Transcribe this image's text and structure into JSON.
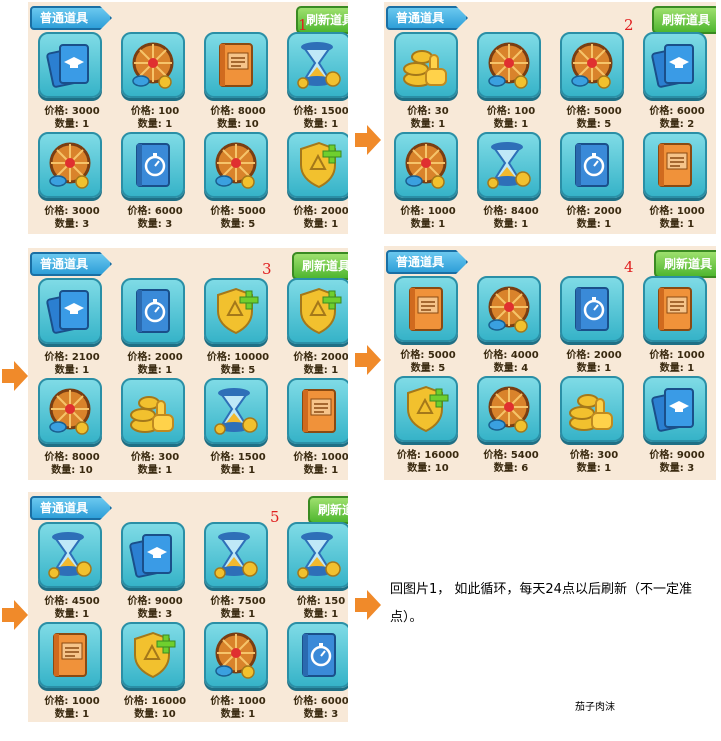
{
  "header": {
    "tab_label": "普通道具",
    "refresh_label": "刷新道具"
  },
  "panels": [
    {
      "index": "1",
      "items": [
        {
          "icon": "cards-icon",
          "price": "价格: 3000",
          "qty": "数量: 1"
        },
        {
          "icon": "wheel-icon",
          "price": "价格: 100",
          "qty": "数量: 1"
        },
        {
          "icon": "book-icon",
          "price": "价格: 8000",
          "qty": "数量: 10"
        },
        {
          "icon": "hourglass-icon",
          "price": "价格: 1500",
          "qty": "数量: 1"
        },
        {
          "icon": "wheel-icon",
          "price": "价格: 3000",
          "qty": "数量: 3"
        },
        {
          "icon": "stopwatch-book-icon",
          "price": "价格: 6000",
          "qty": "数量: 3"
        },
        {
          "icon": "wheel-icon",
          "price": "价格: 5000",
          "qty": "数量: 5"
        },
        {
          "icon": "shield-plus-icon",
          "price": "价格: 2000",
          "qty": "数量: 1"
        }
      ]
    },
    {
      "index": "2",
      "items": [
        {
          "icon": "coin-hand-icon",
          "price": "价格: 30",
          "qty": "数量: 1"
        },
        {
          "icon": "wheel-icon",
          "price": "价格: 100",
          "qty": "数量: 1"
        },
        {
          "icon": "wheel-icon",
          "price": "价格: 5000",
          "qty": "数量: 5"
        },
        {
          "icon": "cards-icon",
          "price": "价格: 6000",
          "qty": "数量: 2"
        },
        {
          "icon": "wheel-icon",
          "price": "价格: 1000",
          "qty": "数量: 1"
        },
        {
          "icon": "hourglass-icon",
          "price": "价格: 8400",
          "qty": "数量: 1"
        },
        {
          "icon": "stopwatch-book-icon",
          "price": "价格: 2000",
          "qty": "数量: 1"
        },
        {
          "icon": "book-icon",
          "price": "价格: 1000",
          "qty": "数量: 1"
        }
      ]
    },
    {
      "index": "3",
      "items": [
        {
          "icon": "cards-icon",
          "price": "价格: 2100",
          "qty": "数量: 1"
        },
        {
          "icon": "stopwatch-book-icon",
          "price": "价格: 2000",
          "qty": "数量: 1"
        },
        {
          "icon": "shield-plus-icon",
          "price": "价格: 10000",
          "qty": "数量: 5"
        },
        {
          "icon": "shield-plus-icon",
          "price": "价格: 2000",
          "qty": "数量: 1"
        },
        {
          "icon": "wheel-icon",
          "price": "价格: 8000",
          "qty": "数量: 10"
        },
        {
          "icon": "coin-hand-icon",
          "price": "价格: 300",
          "qty": "数量: 1"
        },
        {
          "icon": "hourglass-icon",
          "price": "价格: 1500",
          "qty": "数量: 1"
        },
        {
          "icon": "book-icon",
          "price": "价格: 1000",
          "qty": "数量: 1"
        }
      ]
    },
    {
      "index": "4",
      "items": [
        {
          "icon": "book-icon",
          "price": "价格: 5000",
          "qty": "数量: 5"
        },
        {
          "icon": "wheel-icon",
          "price": "价格: 4000",
          "qty": "数量: 4"
        },
        {
          "icon": "stopwatch-book-icon",
          "price": "价格: 2000",
          "qty": "数量: 1"
        },
        {
          "icon": "book-icon",
          "price": "价格: 1000",
          "qty": "数量: 1"
        },
        {
          "icon": "shield-plus-icon",
          "price": "价格: 16000",
          "qty": "数量: 10"
        },
        {
          "icon": "wheel-icon",
          "price": "价格: 5400",
          "qty": "数量: 6"
        },
        {
          "icon": "coin-hand-icon",
          "price": "价格: 300",
          "qty": "数量: 1"
        },
        {
          "icon": "cards-icon",
          "price": "价格: 9000",
          "qty": "数量: 3"
        }
      ]
    },
    {
      "index": "5",
      "items": [
        {
          "icon": "hourglass-icon",
          "price": "价格: 4500",
          "qty": "数量: 1"
        },
        {
          "icon": "cards-icon",
          "price": "价格: 9000",
          "qty": "数量: 3"
        },
        {
          "icon": "hourglass-icon",
          "price": "价格: 7500",
          "qty": "数量: 1"
        },
        {
          "icon": "hourglass-icon",
          "price": "价格: 150",
          "qty": "数量: 1"
        },
        {
          "icon": "book-icon",
          "price": "价格: 1000",
          "qty": "数量: 1"
        },
        {
          "icon": "shield-plus-icon",
          "price": "价格: 16000",
          "qty": "数量: 10"
        },
        {
          "icon": "wheel-icon",
          "price": "价格: 1000",
          "qty": "数量: 1"
        },
        {
          "icon": "stopwatch-book-icon",
          "price": "价格: 6000",
          "qty": "数量: 3"
        }
      ]
    }
  ],
  "note": "回图片1， 如此循环，每天24点以后刷新（不一定准点）。",
  "signature": "茄子肉沫",
  "colors": {
    "arrow": "#f08a2a",
    "panel_bg": "#f8e9d8",
    "tile": "#36b3c8",
    "index_number": "#e02020"
  }
}
